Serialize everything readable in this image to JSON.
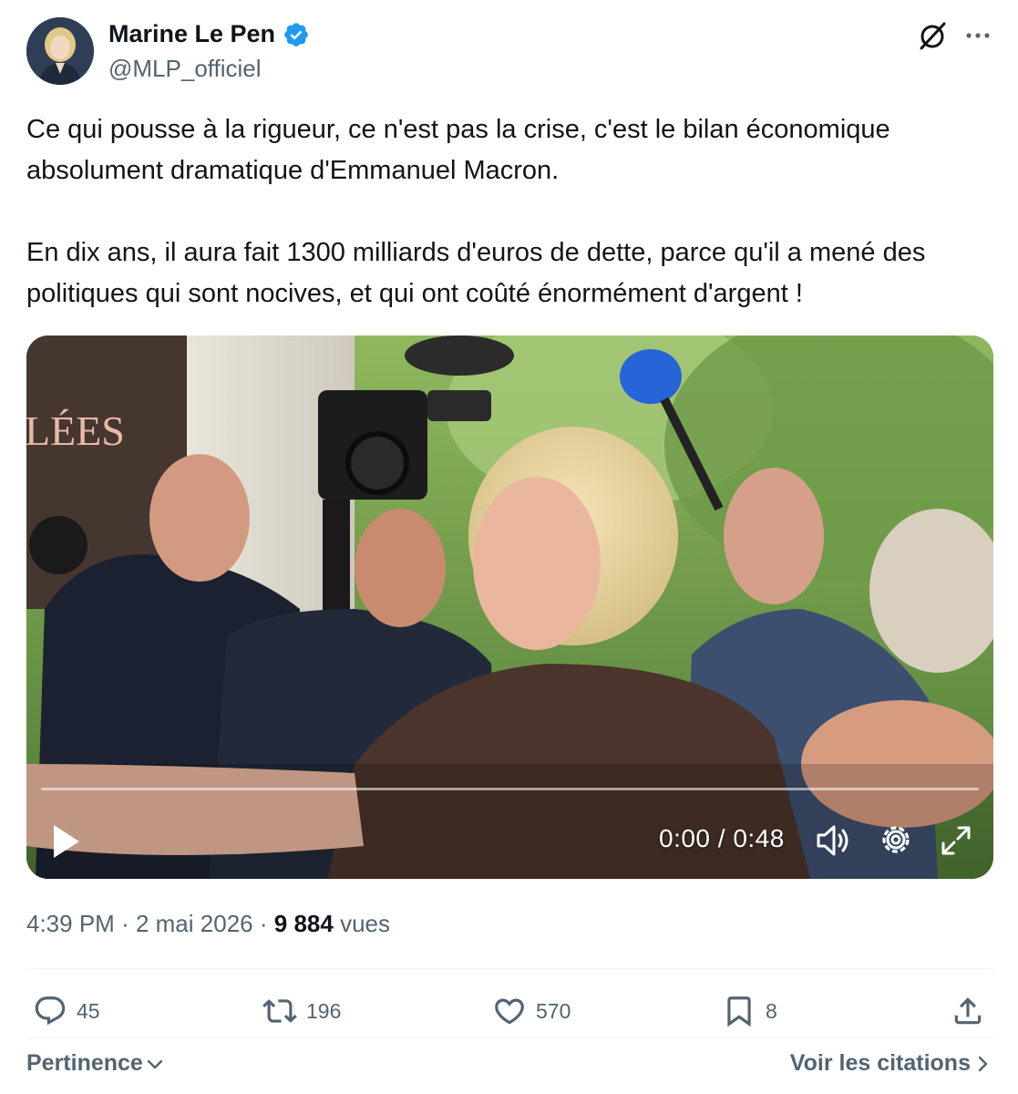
{
  "author": {
    "display_name": "Marine Le Pen",
    "handle": "@MLP_officiel",
    "verified": true,
    "verified_icon": "verified-badge-icon",
    "verified_color": "#1d9bf0"
  },
  "header_actions": {
    "grok_icon": "grok-icon",
    "more_icon": "more-icon"
  },
  "tweet": {
    "paragraphs": [
      "Ce qui pousse à la rigueur, ce n'est pas la crise, c'est le bilan économique absolument dramatique d'Emmanuel Macron.",
      "En dix ans, il aura fait 1300 milliards d'euros de dette, parce qu'il a mené des politiques qui sont nocives, et qui ont coûté énormément d'argent !"
    ]
  },
  "video": {
    "time_text": "0:00 / 0:48",
    "progress": 0,
    "overlay_text": "LÉES",
    "controls": [
      "play-icon",
      "volume-icon",
      "settings-icon",
      "fullscreen-icon"
    ]
  },
  "meta": {
    "time": "4:39 PM",
    "separator": "·",
    "date": "2 mai 2026",
    "views_count": "9 884",
    "views_label": "vues"
  },
  "actions": {
    "replies": "45",
    "reposts": "196",
    "likes": "570",
    "bookmarks": "8"
  },
  "footer": {
    "sort_label": "Pertinence",
    "quotes_label": "Voir les citations"
  },
  "colors": {
    "text": "#0f1419",
    "secondary": "#536471",
    "divider": "#eff3f4"
  }
}
